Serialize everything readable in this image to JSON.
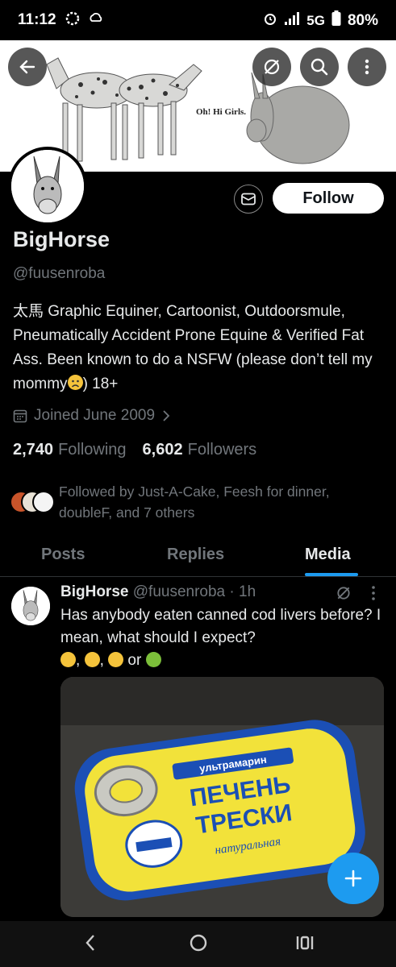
{
  "status_bar": {
    "time": "11:12",
    "network": "5G",
    "battery": "80%"
  },
  "banner": {
    "caption": "Oh! Hi Girls."
  },
  "profile": {
    "name": "BigHorse",
    "handle": "@fuusenroba",
    "follow_label": "Follow",
    "bio": "太馬 Graphic Equiner, Cartoonist, Outdoorsmule, Pneumatically Accident Prone Equine & Verified Fat Ass. Been known to do a NSFW (please don’t tell my mommy",
    "bio_end": ") 18+",
    "joined": "Joined June 2009",
    "following_count": "2,740",
    "following_label": "Following",
    "followers_count": "6,602",
    "followers_label": "Followers",
    "followed_by": "Followed by Just-A-Cake, Feesh for dinner, doubleF, and 7 others"
  },
  "tabs": [
    {
      "label": "Posts"
    },
    {
      "label": "Replies"
    },
    {
      "label": "Media",
      "active": true
    }
  ],
  "post": {
    "name": "BigHorse",
    "handle_time": "@fuusenroba · 1h",
    "text_line1": "Has anybody eaten canned cod livers before? I mean, what should I expect?",
    "sep1": ",",
    "sep2": ",",
    "sep3": "or",
    "can_brand": "ультрамарин",
    "can_title1": "ПЕЧЕНЬ",
    "can_title2": "ТРЕСКИ",
    "can_sub": "натуральная"
  },
  "colors": {
    "accent": "#1d9bf0",
    "background": "#000000",
    "muted": "#71767b"
  }
}
